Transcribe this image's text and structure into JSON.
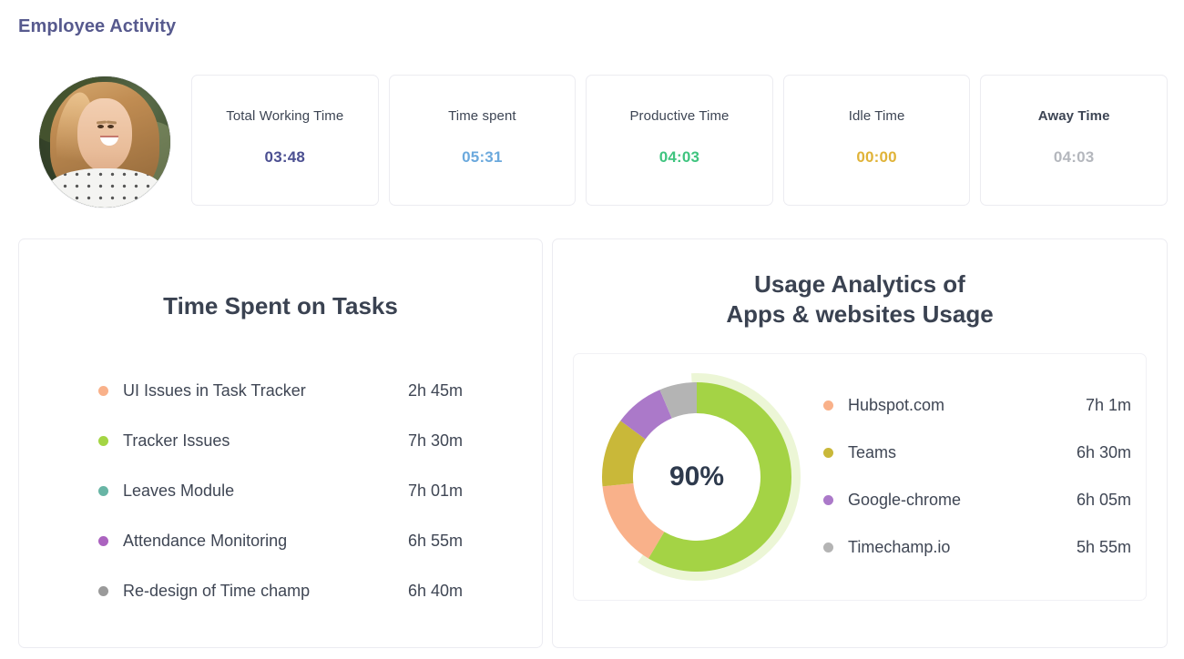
{
  "page": {
    "title": "Employee Activity"
  },
  "avatar": {
    "alt": "Employee profile photo"
  },
  "summary": {
    "cards": [
      {
        "label": "Total Working Time",
        "value": "03:48",
        "color": "#4b4f91",
        "bold_label": false
      },
      {
        "label": "Time spent",
        "value": "05:31",
        "color": "#6ba9dd",
        "bold_label": false
      },
      {
        "label": "Productive Time",
        "value": "04:03",
        "color": "#3fc47f",
        "bold_label": false
      },
      {
        "label": "Idle Time",
        "value": "00:00",
        "color": "#e0b338",
        "bold_label": false
      },
      {
        "label": "Away Time",
        "value": "04:03",
        "color": "#b4b7bd",
        "bold_label": true
      }
    ]
  },
  "tasks_panel": {
    "title": "Time Spent on Tasks",
    "items": [
      {
        "name": "UI Issues in Task Tracker",
        "time": "2h 45m",
        "color": "#f9b18a"
      },
      {
        "name": "Tracker Issues",
        "time": "7h 30m",
        "color": "#a4d544"
      },
      {
        "name": "Leaves Module",
        "time": "7h 01m",
        "color": "#68b5a5"
      },
      {
        "name": "Attendance Monitoring",
        "time": "6h 55m",
        "color": "#ab63bf"
      },
      {
        "name": "Re-design of Time champ",
        "time": "6h 40m",
        "color": "#9a9a9a"
      }
    ]
  },
  "usage_panel": {
    "title_line1": "Usage Analytics of",
    "title_line2": "Apps & websites Usage",
    "center_label": "90%",
    "items": [
      {
        "name": "Hubspot.com",
        "time": "7h 1m",
        "color": "#f9b18a"
      },
      {
        "name": "Teams",
        "time": "6h 30m",
        "color": "#c9b839"
      },
      {
        "name": "Google-chrome",
        "time": "6h 05m",
        "color": "#ab79c9"
      },
      {
        "name": "Timechamp.io",
        "time": "5h 55m",
        "color": "#b4b4b4"
      }
    ]
  },
  "chart_data": {
    "type": "pie",
    "title": "Usage Analytics of Apps & websites Usage",
    "center_label": "90%",
    "unit": "hours",
    "labels": [
      "Apps & websites Usage",
      "Hubspot.com",
      "Teams",
      "Google-chrome",
      "Timechamp.io"
    ],
    "values": [
      55,
      14,
      11,
      8,
      6
    ],
    "display_values": [
      "",
      "7h 1m",
      "6h 30m",
      "6h 05m",
      "5h 55m"
    ],
    "colors": [
      "#a4d345",
      "#f9b18a",
      "#c9b839",
      "#ab79c9",
      "#b4b4b4"
    ],
    "legend_position": "right",
    "donut": true,
    "hole_ratio": 0.62,
    "start_angle_deg": 0,
    "direction": "clockwise",
    "glow_color": "#dcefb4"
  }
}
